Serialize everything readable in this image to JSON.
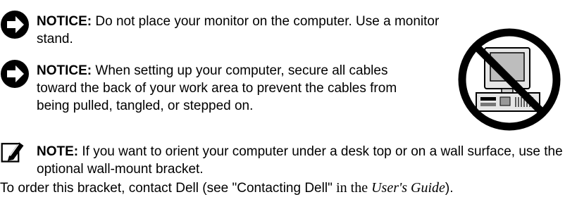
{
  "notices": [
    {
      "label": "NOTICE:",
      "text": "Do not place your monitor on the computer. Use a monitor stand.",
      "icon": "notice-arrow-icon"
    },
    {
      "label": "NOTICE:",
      "text": "When setting up your computer, secure all cables toward the back of your work area to prevent the cables from being pulled, tangled, or stepped on.",
      "icon": "notice-arrow-icon"
    }
  ],
  "note": {
    "label": "NOTE:",
    "text": "If you want to orient your computer under a desk top or on a wall surface, use the optional wall-mount bracket.",
    "tail_prefix": "To order this bracket, contact Dell (see \"Contacting Dell\" ",
    "tail_in": "in the ",
    "tail_guide": "User's Guide",
    "tail_end": ").",
    "icon": "pencil-note-icon"
  },
  "illustration": {
    "icon": "no-monitor-on-computer-icon",
    "colors": {
      "prohibition": "#000000",
      "screen": "#bdbdbd",
      "body": "#e6e6e6"
    }
  }
}
